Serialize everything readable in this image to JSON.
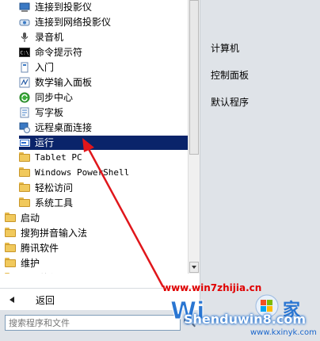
{
  "programs": [
    {
      "label": "连接到投影仪",
      "icon": "projector-icon"
    },
    {
      "label": "连接到网络投影仪",
      "icon": "network-projector-icon"
    },
    {
      "label": "录音机",
      "icon": "microphone-icon"
    },
    {
      "label": "命令提示符",
      "icon": "command-prompt-icon"
    },
    {
      "label": "入门",
      "icon": "getting-started-icon"
    },
    {
      "label": "数学输入面板",
      "icon": "math-input-icon"
    },
    {
      "label": "同步中心",
      "icon": "sync-center-icon"
    },
    {
      "label": "写字板",
      "icon": "wordpad-icon"
    },
    {
      "label": "远程桌面连接",
      "icon": "remote-desktop-icon"
    },
    {
      "label": "运行",
      "icon": "run-icon",
      "selected": true
    },
    {
      "label": "Tablet PC",
      "icon": "folder-icon"
    },
    {
      "label": "Windows PowerShell",
      "icon": "folder-icon"
    },
    {
      "label": "轻松访问",
      "icon": "folder-icon"
    },
    {
      "label": "系统工具",
      "icon": "folder-icon"
    },
    {
      "label": "启动",
      "icon": "folder-icon"
    },
    {
      "label": "搜狗拼音输入法",
      "icon": "folder-icon"
    },
    {
      "label": "腾讯软件",
      "icon": "folder-icon"
    },
    {
      "label": "维护",
      "icon": "folder-icon"
    },
    {
      "label": "迅雷软件",
      "icon": "folder-icon"
    }
  ],
  "back_label": "返回",
  "search": {
    "placeholder": "搜索程序和文件"
  },
  "right_items": [
    "计算机",
    "控制面板",
    "默认程序"
  ],
  "watermark": {
    "url": "www.win7zhijia.cn",
    "brand": "Shenduwin8.com",
    "brand_url": "www.kxinyk.com"
  },
  "colors": {
    "selection": "#0a246a",
    "right_panel": "#dfe3e8",
    "arrow": "#e0161b"
  }
}
